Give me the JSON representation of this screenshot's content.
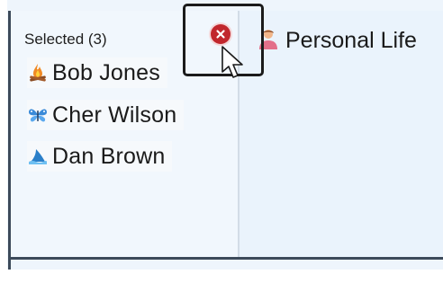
{
  "left_pane": {
    "header": "Selected (3)",
    "people": [
      {
        "name": "Bob Jones",
        "icon": "campfire-icon"
      },
      {
        "name": "Cher Wilson",
        "icon": "butterfly-icon"
      },
      {
        "name": "Dan Brown",
        "icon": "shark-fin-icon"
      }
    ]
  },
  "right_pane": {
    "group_label": "Personal Life",
    "group_icon": "person-icon"
  },
  "remove_button": {
    "icon": "close-icon",
    "color": "#c1272d"
  },
  "colors": {
    "window_bg": "#eef5fc",
    "highlight_box": "#1b1b1b"
  }
}
